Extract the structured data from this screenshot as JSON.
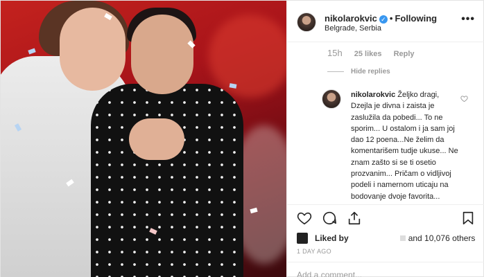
{
  "post": {
    "username": "nikolarokvic",
    "verified_glyph": "✓",
    "separator": "•",
    "follow_status": "Following",
    "location": "Belgrade, Serbia",
    "more_icon": "more-options-icon"
  },
  "thread": {
    "parent_time": "15h",
    "parent_likes": "25 likes",
    "parent_reply": "Reply",
    "hide_replies": "Hide replies"
  },
  "reply": {
    "username": "nikolarokvic",
    "text": "Željko dragi, Dzejla je divna i zaista je zaslužila da pobedi... To ne sporim... U ostalom i ja sam joj dao 12 poena...Ne želim da komentarišem tudje ukuse... Ne znam zašto si se ti osetio prozvanim... Pričam o vidljivoj podeli i namernom uticaju na bodovanje dvoje favorita..."
  },
  "actions": {
    "liked_by_label": "Liked by",
    "liked_tail": "and 10,076 others",
    "time_ago": "1 DAY AGO",
    "add_comment_placeholder": "Add a comment..."
  },
  "colors": {
    "verified": "#3897f0",
    "muted": "#999999",
    "text": "#262626"
  }
}
